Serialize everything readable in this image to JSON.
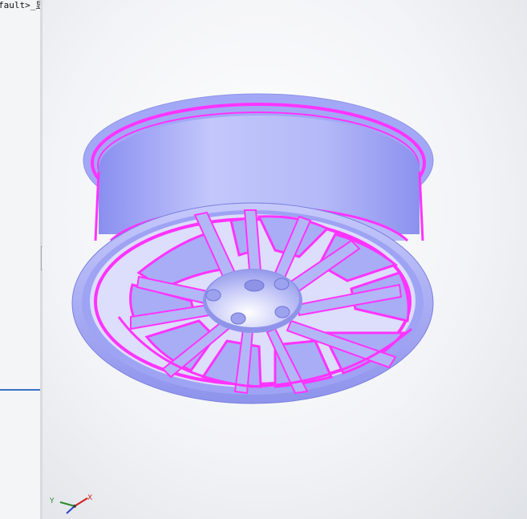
{
  "feature_tree": {
    "config_text": "fault>_显"
  },
  "viewport": {
    "model": "wheel-rim",
    "colors": {
      "body": "#a9aef6",
      "body_shade": "#7c82e8",
      "highlight_edges": "#ff33ff",
      "selected_edge": "#ff8a2a",
      "background": "#f2f3f6"
    }
  },
  "triad": {
    "x_label": "X",
    "y_label": "Y",
    "x_color": "#d21e1e",
    "y_color": "#2a8a2a",
    "z_color": "#2a3fd0"
  }
}
